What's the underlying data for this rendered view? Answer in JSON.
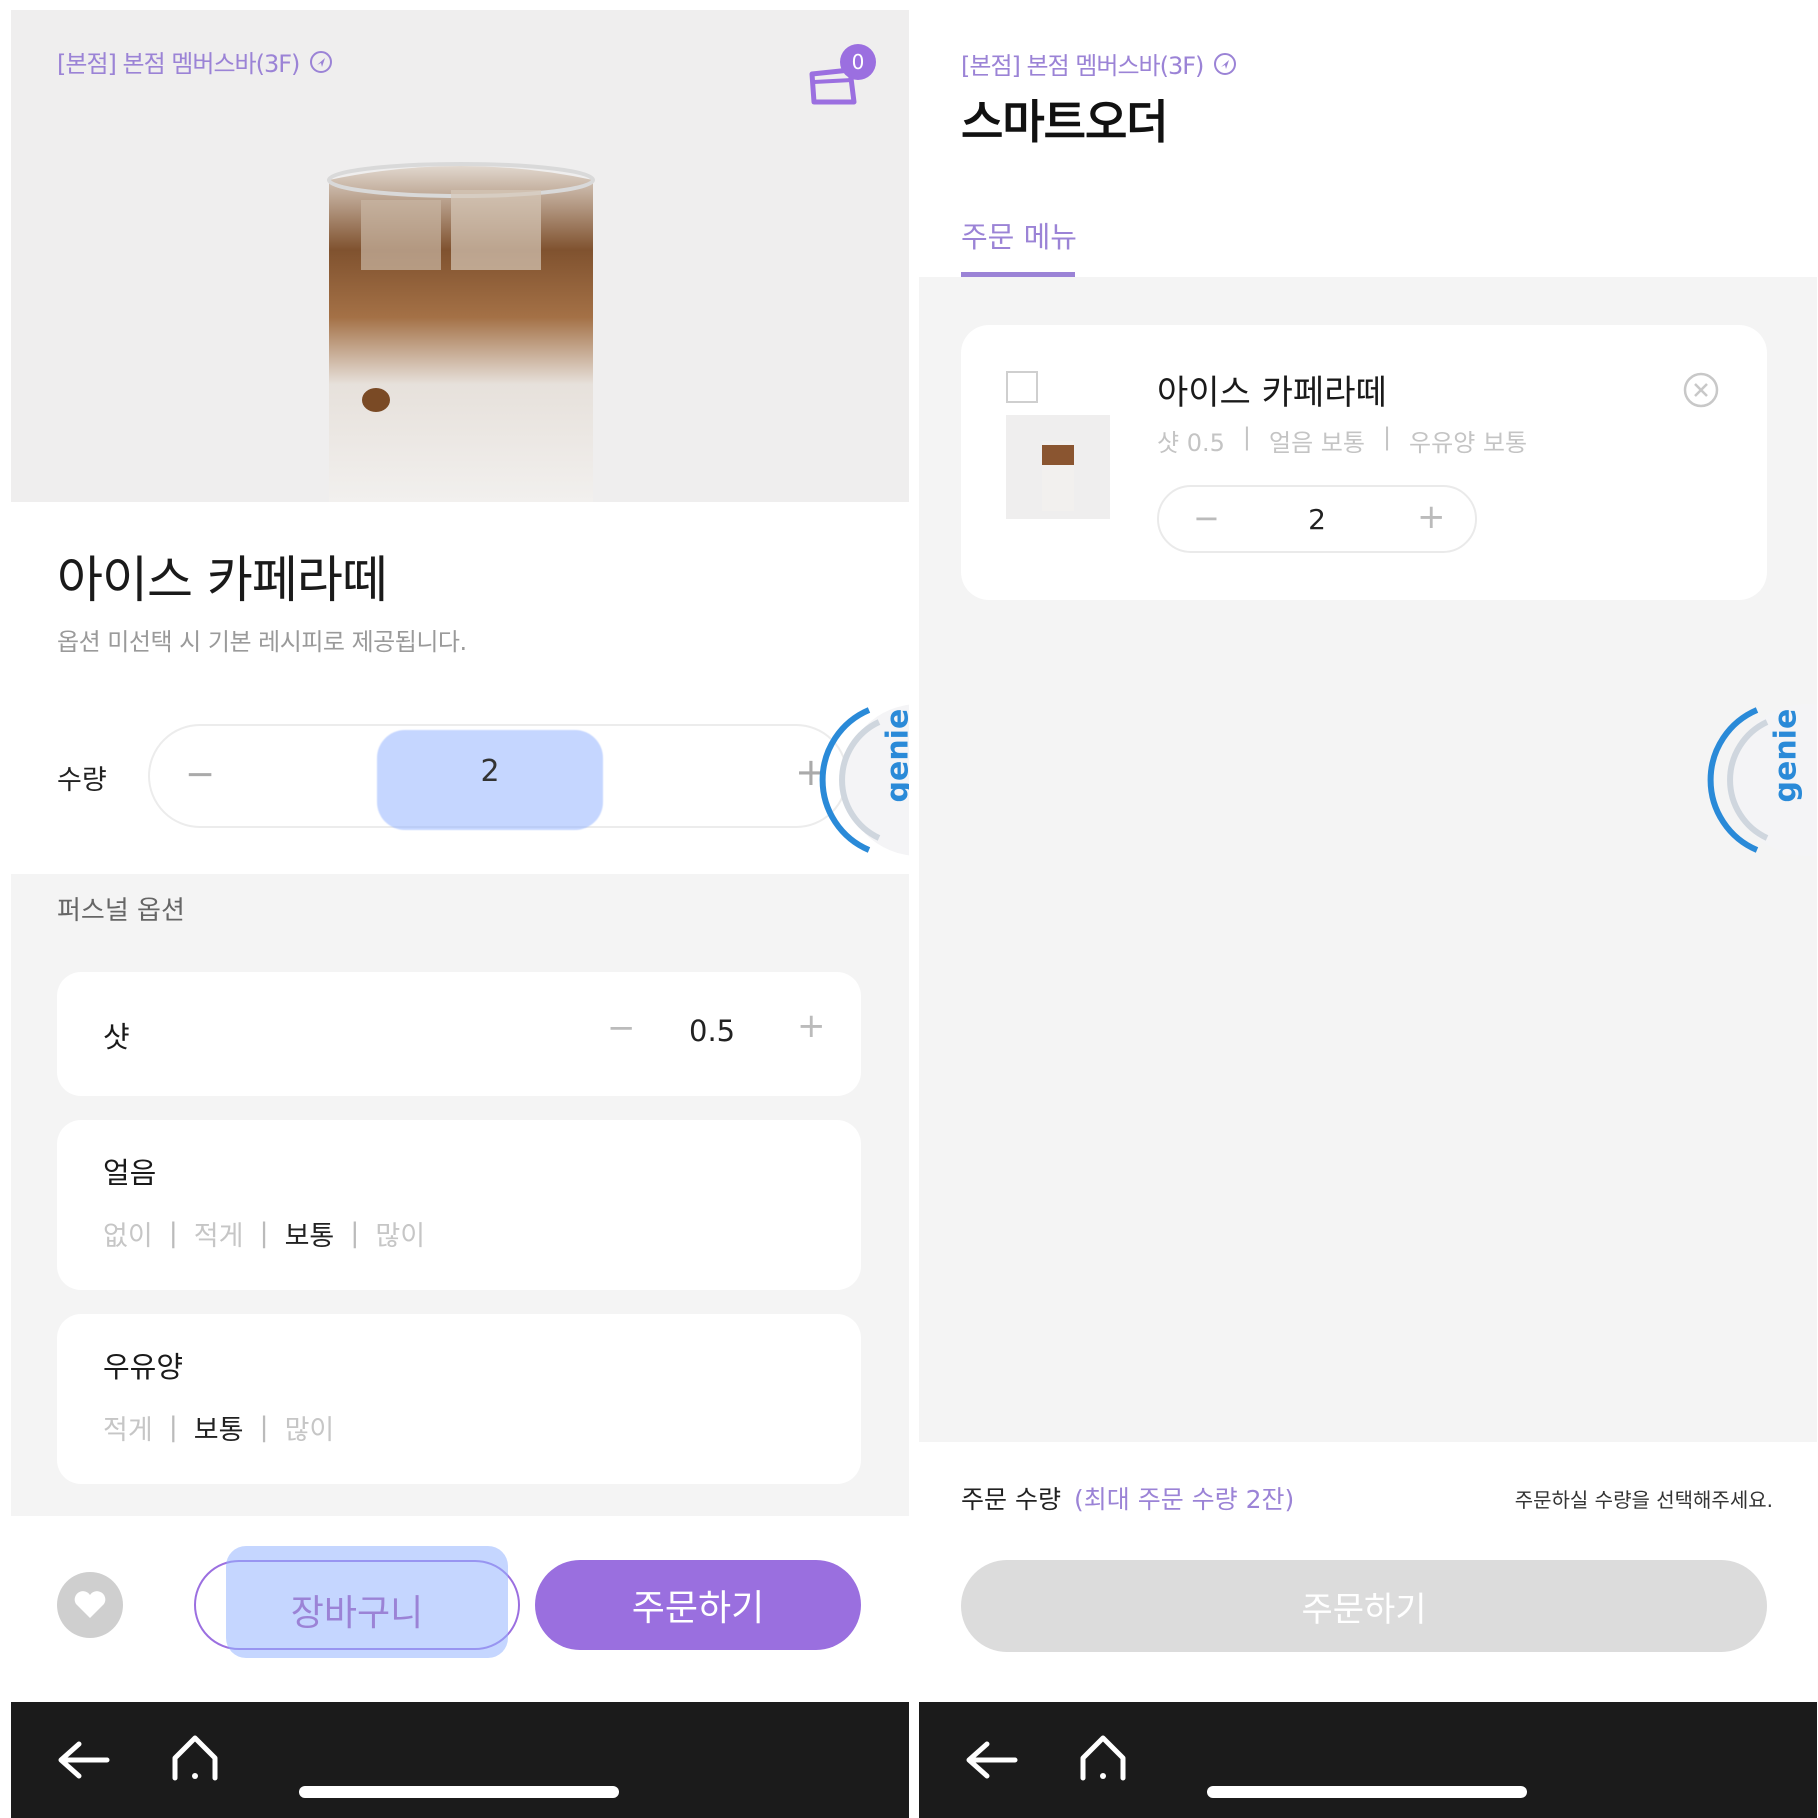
{
  "left": {
    "store_name": "[본점] 본점 멤버스바(3F)",
    "cart_count": "0",
    "product": {
      "title": "아이스 카페라떼",
      "description": "옵션 미선택 시 기본 레시피로 제공됩니다."
    },
    "quantity": {
      "label": "수량",
      "minus": "−",
      "value": "2",
      "plus": "+"
    },
    "genie_label": "genie",
    "options_header": "퍼스널 옵션",
    "options": {
      "shot": {
        "title": "샷",
        "minus": "−",
        "value": "0.5",
        "plus": "+"
      },
      "ice": {
        "title": "얼음",
        "choices": [
          "없이",
          "적게",
          "보통",
          "많이"
        ],
        "selected": "보통"
      },
      "milk": {
        "title": "우유양",
        "choices": [
          "적게",
          "보통",
          "많이"
        ],
        "selected": "보통"
      }
    },
    "cart_button": "장바구니",
    "order_button": "주문하기"
  },
  "right": {
    "store_name": "[본점] 본점 멤버스바(3F)",
    "page_title": "스마트오더",
    "tab_label": "주문 메뉴",
    "item": {
      "name": "아이스 카페라떼",
      "options": [
        "샷 0.5",
        "얼음 보통",
        "우유양 보통"
      ],
      "separator": "|",
      "qty_minus": "−",
      "qty_value": "2",
      "qty_plus": "+"
    },
    "genie_label": "genie",
    "order_qty_label": "주문 수량",
    "order_qty_max": "(최대 주문 수량 2잔)",
    "order_hint": "주문하실 수량을 선택해주세요.",
    "order_button": "주문하기"
  },
  "colors": {
    "accent": "#9a6fdf",
    "accent_text": "#9b83d6",
    "nav_bar": "#1b1b1b",
    "genie_blue": "#2a8ad8"
  },
  "icons": [
    "location-arrow-icon",
    "cart-icon",
    "heart-icon",
    "back-arrow-icon",
    "home-icon",
    "close-circle-icon",
    "genie-icon"
  ]
}
